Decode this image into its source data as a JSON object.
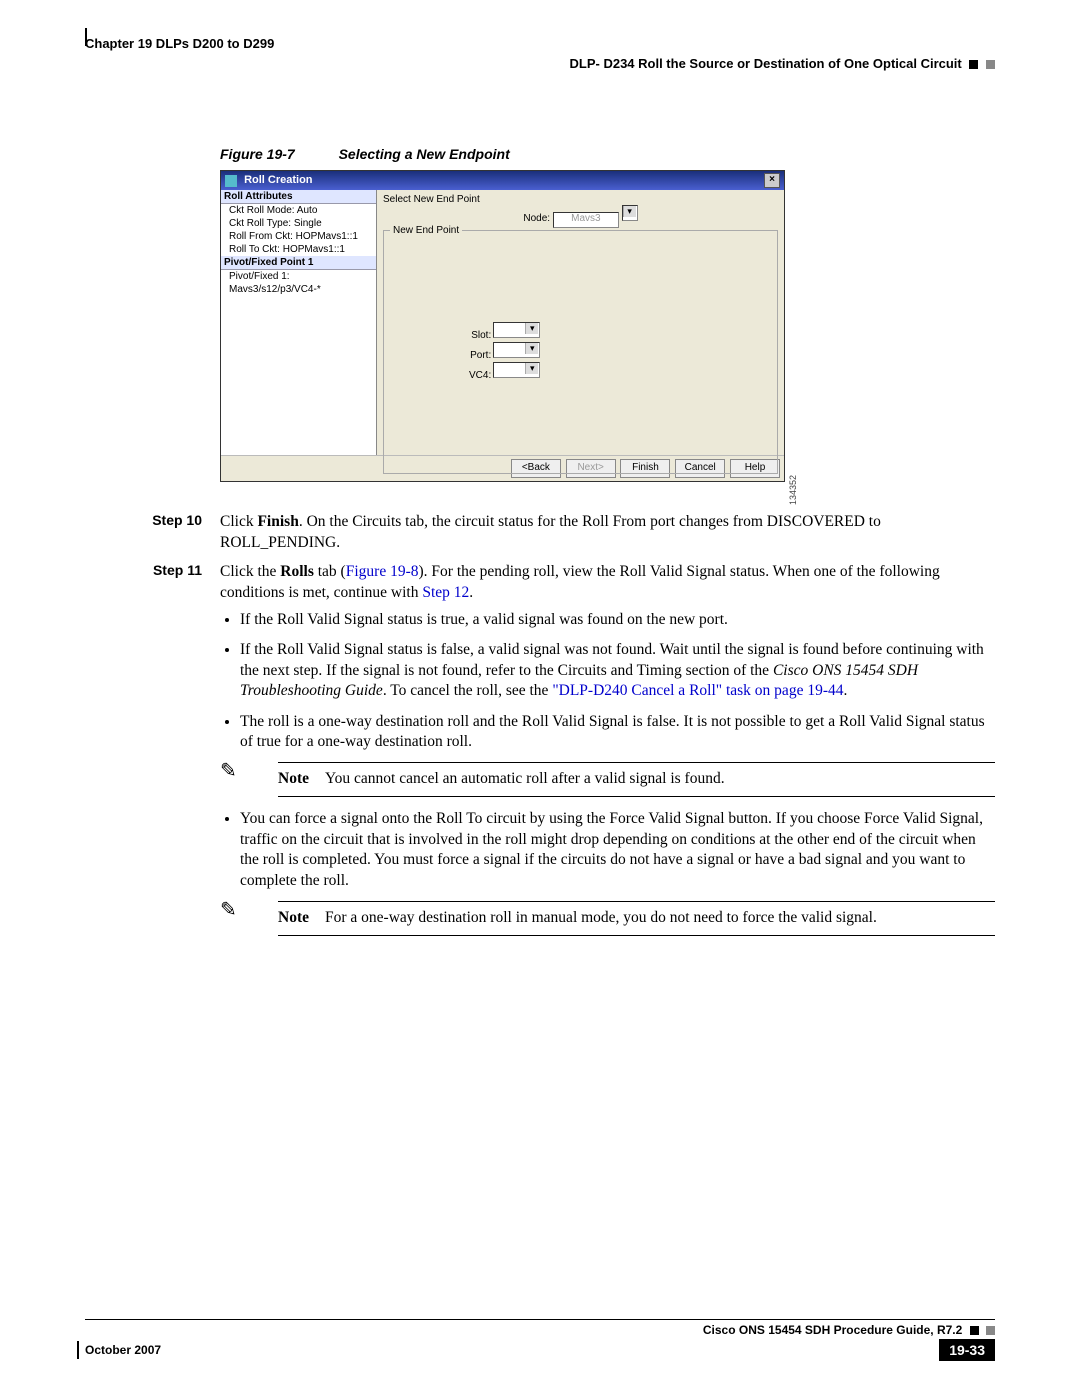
{
  "header": {
    "chapter": "Chapter 19 DLPs D200 to D299",
    "section": "DLP- D234 Roll the Source or Destination of One Optical Circuit"
  },
  "figure": {
    "num": "Figure 19-7",
    "title": "Selecting a New Endpoint",
    "imgnum": "134352"
  },
  "dialog": {
    "title": "Roll Creation",
    "leftPanes": {
      "attrs_h": "Roll Attributes",
      "attrs": [
        "Ckt Roll Mode: Auto",
        "Ckt Roll Type: Single",
        "Roll From Ckt: HOPMavs1::1",
        "Roll To Ckt: HOPMavs1::1"
      ],
      "pivot_h": "Pivot/Fixed Point 1",
      "pivot": "Pivot/Fixed 1: Mavs3/s12/p3/VC4-*"
    },
    "right": {
      "select_label": "Select New End Point",
      "fs_legend": "New End Point",
      "node_label": "Node:",
      "node_value": "Mavs3",
      "slot_label": "Slot:",
      "port_label": "Port:",
      "vc4_label": "VC4:"
    },
    "buttons": {
      "back": "<Back",
      "next": "Next>",
      "finish": "Finish",
      "cancel": "Cancel",
      "help": "Help"
    }
  },
  "steps": {
    "s10_label": "Step 10",
    "s10_a": "Click ",
    "s10_b": "Finish",
    "s10_c": ". On the Circuits tab, the circuit status for the Roll From port changes from DISCOVERED to ROLL_PENDING.",
    "s11_label": "Step 11",
    "s11_a": "Click the ",
    "s11_b": "Rolls",
    "s11_c": " tab (",
    "s11_link1": "Figure 19-8",
    "s11_d": "). For the pending roll, view the Roll Valid Signal status. When one of the following conditions is met, continue with ",
    "s11_link2": "Step 12",
    "s11_e": "."
  },
  "bullets": {
    "b1": "If the Roll Valid Signal status is true, a valid signal was found on the new port.",
    "b2_a": "If the Roll Valid Signal status is false, a valid signal was not found. Wait until the signal is found before continuing with the next step. If the signal is not found, refer to the Circuits and Timing section of the ",
    "b2_i": "Cisco ONS 15454 SDH Troubleshooting Guide",
    "b2_b": ". To cancel the roll, see the ",
    "b2_link": "\"DLP-D240 Cancel a Roll\" task on page 19-44",
    "b2_c": ".",
    "b3": "The roll is a one-way destination roll and the Roll Valid Signal is false. It is not possible to get a Roll Valid Signal status of true for a one-way destination roll.",
    "b4": "You can force a signal onto the Roll To circuit by using the Force Valid Signal button. If you choose Force Valid Signal, traffic on the circuit that is involved in the roll might drop depending on conditions at the other end of the circuit when the roll is completed. You must force a signal if the circuits do not have a signal or have a bad signal and you want to complete the roll."
  },
  "notes": {
    "label": "Note",
    "n1": "You cannot cancel an automatic roll after a valid signal is found.",
    "n2": "For a one-way destination roll in manual mode, you do not need to force the valid signal."
  },
  "footer": {
    "guide": "Cisco ONS 15454 SDH Procedure Guide, R7.2",
    "date": "October 2007",
    "page": "19-33"
  }
}
